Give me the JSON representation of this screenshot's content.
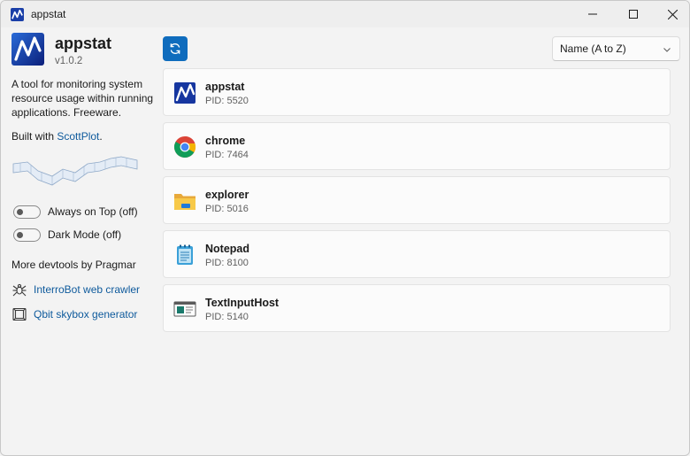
{
  "window": {
    "title": "appstat"
  },
  "sidebar": {
    "app_name": "appstat",
    "version": "v1.0.2",
    "description": "A tool for monitoring system resource usage within running applications. Freeware.",
    "built_with_prefix": "Built with ",
    "built_with_link": "ScottPlot",
    "built_with_suffix": ".",
    "toggles": [
      {
        "label": "Always on Top (off)",
        "on": false
      },
      {
        "label": "Dark Mode (off)",
        "on": false
      }
    ],
    "more_devtools": "More devtools by Pragmar",
    "tools": [
      {
        "label": "InterroBot web crawler",
        "icon": "spider-icon"
      },
      {
        "label": "Qbit skybox generator",
        "icon": "cube-icon"
      }
    ]
  },
  "toolbar": {
    "refresh_icon": "refresh-icon",
    "sort_value": "Name (A to Z)"
  },
  "processes": [
    {
      "name": "appstat",
      "pid": "PID: 5520",
      "icon": "appstat-icon"
    },
    {
      "name": "chrome",
      "pid": "PID: 7464",
      "icon": "chrome-icon"
    },
    {
      "name": "explorer",
      "pid": "PID: 5016",
      "icon": "folder-icon"
    },
    {
      "name": "Notepad",
      "pid": "PID: 8100",
      "icon": "notepad-icon"
    },
    {
      "name": "TextInputHost",
      "pid": "PID: 5140",
      "icon": "textinput-icon"
    }
  ],
  "colors": {
    "accent": "#0f6cbd",
    "link": "#0e5a9c",
    "background": "#f3f3f3",
    "card": "#fbfbfb"
  }
}
